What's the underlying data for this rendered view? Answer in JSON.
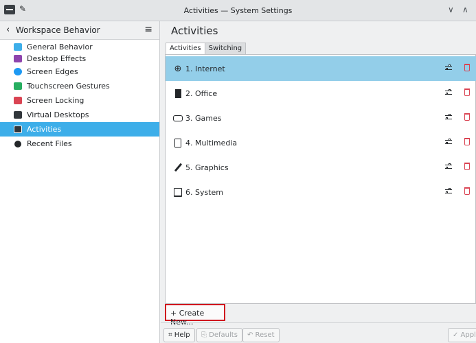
{
  "window": {
    "title": "Activities — System Settings",
    "pin_icon": "pin-icon",
    "minimize_icon": "chevron-down-icon",
    "maximize_icon": "chevron-up-icon"
  },
  "sidebar": {
    "back_glyph": "‹",
    "title": "Workspace Behavior",
    "menu_glyph": "≡",
    "items": [
      {
        "label": "General Behavior",
        "icon": "general-behavior-icon",
        "color": "#3daee9"
      },
      {
        "label": "Desktop Effects",
        "icon": "desktop-effects-icon",
        "color": "#8e44ad"
      },
      {
        "label": "Screen Edges",
        "icon": "screen-edges-icon",
        "color": "#1d99f3"
      },
      {
        "label": "Touchscreen Gestures",
        "icon": "touchscreen-icon",
        "color": "#27ae60"
      },
      {
        "label": "Screen Locking",
        "icon": "screen-lock-icon",
        "color": "#da4453"
      },
      {
        "label": "Virtual Desktops",
        "icon": "virtual-desktops-icon",
        "color": "#31363b"
      },
      {
        "label": "Activities",
        "icon": "activities-icon",
        "color": "#31363b",
        "active": true
      },
      {
        "label": "Recent Files",
        "icon": "recent-files-icon",
        "color": "#232629"
      }
    ]
  },
  "main": {
    "title": "Activities",
    "tabs": [
      {
        "label": "Activities",
        "active": true
      },
      {
        "label": "Switching",
        "active": false
      }
    ],
    "activities": [
      {
        "name": "1. Internet",
        "icon": "globe-icon",
        "glyph": "🌐",
        "selected": true
      },
      {
        "name": "2. Office",
        "icon": "office-icon",
        "glyph": "▮",
        "selected": false
      },
      {
        "name": "3. Games",
        "icon": "gamepad-icon",
        "glyph": "🎮",
        "selected": false
      },
      {
        "name": "4. Multimedia",
        "icon": "speaker-icon",
        "glyph": "⊡",
        "selected": false
      },
      {
        "name": "5. Graphics",
        "icon": "brush-icon",
        "glyph": "╱",
        "selected": false
      },
      {
        "name": "6. System",
        "icon": "computer-icon",
        "glyph": "☐",
        "selected": false
      }
    ],
    "create_new_label": "+ Create New..."
  },
  "footer": {
    "help_label": "⌗ Help",
    "defaults_label": "⎘ Defaults",
    "reset_label": "↶ Reset",
    "apply_label": "✓ Apply"
  },
  "colors": {
    "accent": "#3daee9",
    "selection": "#93cee9",
    "delete": "#da4453",
    "highlight_border": "#d0101e"
  }
}
